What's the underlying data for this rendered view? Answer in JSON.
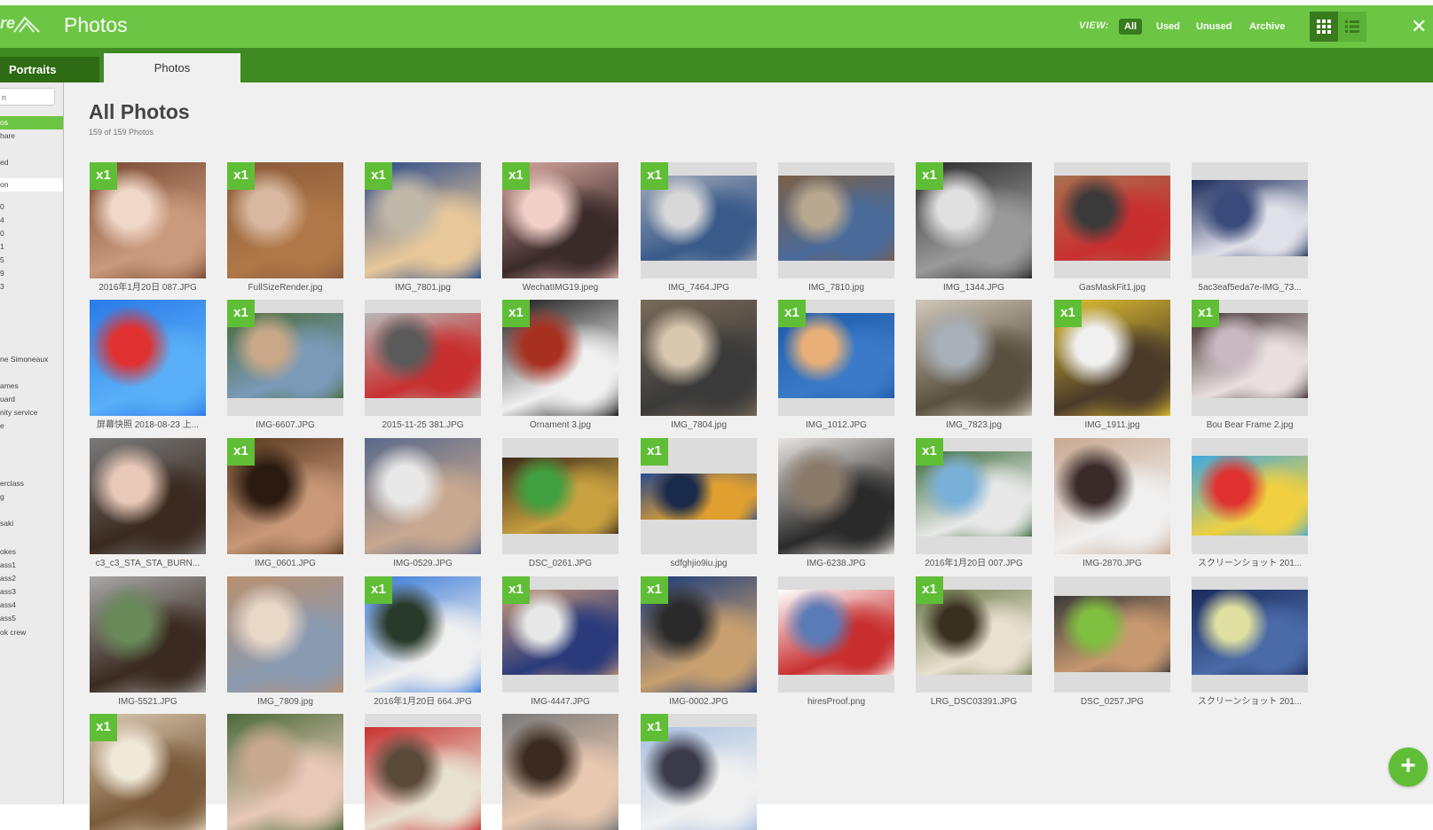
{
  "header": {
    "logo_text": "re",
    "app_title": "Photos",
    "view_label": "VIEW:",
    "view_options": [
      "All",
      "Used",
      "Unused",
      "Archive"
    ],
    "active_view": "All",
    "accent_color": "#6cc644"
  },
  "tabs": [
    {
      "label": "Portraits"
    },
    {
      "label": "Photos"
    }
  ],
  "sidebar": {
    "search_value": "n",
    "items": [
      "os",
      "hare",
      "ed",
      "on",
      "0",
      "4",
      "0",
      "1",
      "5",
      "9",
      "3",
      "",
      "ne Simoneaux",
      "ames",
      "uard",
      "nity service",
      "e",
      "erclass",
      "g",
      "saki",
      "okes",
      "ass1",
      "ass2",
      "ass3",
      "ass4",
      "ass5",
      "ok crew"
    ]
  },
  "main": {
    "heading": "All Photos",
    "count": "159 of 159 Photos",
    "badge_text": "x1",
    "photos": [
      {
        "name": "2016年1月20日 087.JPG",
        "badge": true,
        "palette": [
          "#7a4a34",
          "#c99a7c",
          "#f0d8c8"
        ]
      },
      {
        "name": "FullSizeRender.jpg",
        "badge": true,
        "palette": [
          "#8a5a3a",
          "#b07848",
          "#d8b8a0"
        ]
      },
      {
        "name": "IMG_7801.jpg",
        "badge": true,
        "palette": [
          "#2a4a8a",
          "#e8c89a",
          "#c0b8a8"
        ]
      },
      {
        "name": "WechatIMG19.jpeg",
        "badge": true,
        "palette": [
          "#d8a8a0",
          "#3a2a2a",
          "#f0d0c8"
        ]
      },
      {
        "name": "IMG_7464.JPG",
        "badge": true,
        "palette": [
          "#a0a8b8",
          "#3a5a8a",
          "#d8d8d8"
        ]
      },
      {
        "name": "IMG_7810.jpg",
        "badge": false,
        "palette": [
          "#7a6048",
          "#4a6a9a",
          "#b8a890"
        ]
      },
      {
        "name": "IMG_1344.JPG",
        "badge": true,
        "palette": [
          "#2a2a2a",
          "#9a9a9a",
          "#e0e0e0"
        ]
      },
      {
        "name": "GasMaskFit1.jpg",
        "badge": false,
        "palette": [
          "#a87050",
          "#c83030",
          "#3a3a3a"
        ]
      },
      {
        "name": "5ac3eaf5eda7e-IMG_73...",
        "badge": false,
        "palette": [
          "#1a2a5a",
          "#e0e0e8",
          "#3a4a7a"
        ]
      },
      {
        "name": "屏幕快照 2018-08-23 上...",
        "badge": false,
        "palette": [
          "#2a7ae8",
          "#5ab0f8",
          "#e03030"
        ]
      },
      {
        "name": "IMG-6607.JPG",
        "badge": true,
        "palette": [
          "#4a6a3a",
          "#7a9ab8",
          "#c8a888"
        ]
      },
      {
        "name": "2015-11-25 381.JPG",
        "badge": false,
        "palette": [
          "#b8b8b8",
          "#c83030",
          "#5a5a5a"
        ]
      },
      {
        "name": "Ornament 3.jpg",
        "badge": true,
        "palette": [
          "#1a1a1a",
          "#f0f0f0",
          "#a83020"
        ]
      },
      {
        "name": "IMG_7804.jpg",
        "badge": false,
        "palette": [
          "#7a6a58",
          "#3a3a3a",
          "#d8c8b0"
        ]
      },
      {
        "name": "IMG_1012.JPG",
        "badge": true,
        "palette": [
          "#1a5aa8",
          "#3a7ac8",
          "#e8b078"
        ]
      },
      {
        "name": "IMG_7823.jpg",
        "badge": false,
        "palette": [
          "#d0c8b8",
          "#5a5040",
          "#a8b0b8"
        ]
      },
      {
        "name": "IMG_1911.jpg",
        "badge": true,
        "palette": [
          "#e0c030",
          "#4a3a2a",
          "#f0f0f0"
        ]
      },
      {
        "name": "Bou Bear Frame 2.jpg",
        "badge": true,
        "palette": [
          "#3a2a2a",
          "#e8e0e0",
          "#c8b8c0"
        ]
      },
      {
        "name": "c3_c3_STA_STA_BURN...",
        "badge": false,
        "palette": [
          "#7a7a7a",
          "#3a2a20",
          "#e8c8b8"
        ]
      },
      {
        "name": "IMG_0601.JPG",
        "badge": true,
        "palette": [
          "#5a3a20",
          "#c89878",
          "#2a1a10"
        ]
      },
      {
        "name": "IMG-0529.JPG",
        "badge": false,
        "palette": [
          "#5a6a8a",
          "#c8a890",
          "#e8e8e8"
        ]
      },
      {
        "name": "DSC_0261.JPG",
        "badge": false,
        "palette": [
          "#3a2a1a",
          "#c8a040",
          "#40a040"
        ]
      },
      {
        "name": "sdfghjio9iu.jpg",
        "badge": true,
        "palette": [
          "#2a4a8a",
          "#e0a030",
          "#1a2a4a"
        ]
      },
      {
        "name": "IMG-6238.JPG",
        "badge": false,
        "palette": [
          "#e8e4e0",
          "#2a2a2a",
          "#8a7a6a"
        ]
      },
      {
        "name": "2016年1月20日 007.JPG",
        "badge": true,
        "palette": [
          "#3a6a3a",
          "#e8e8e8",
          "#7ab0d8"
        ]
      },
      {
        "name": "IMG-2870.JPG",
        "badge": false,
        "palette": [
          "#c8a890",
          "#f0f0f0",
          "#3a2a2a"
        ]
      },
      {
        "name": "スクリーンショット 201...",
        "badge": false,
        "palette": [
          "#40a8e0",
          "#f0d040",
          "#e03030"
        ]
      },
      {
        "name": "IMG-5521.JPG",
        "badge": false,
        "palette": [
          "#a8a8a8",
          "#3a2a20",
          "#6a8a5a"
        ]
      },
      {
        "name": "IMG_7809.jpg",
        "badge": false,
        "palette": [
          "#b89070",
          "#8a9ab0",
          "#e8d8c8"
        ]
      },
      {
        "name": "2016年1月20日 664.JPG",
        "badge": true,
        "palette": [
          "#3a7ad8",
          "#f0f0f0",
          "#2a3a2a"
        ]
      },
      {
        "name": "IMG-4447.JPG",
        "badge": true,
        "palette": [
          "#c89878",
          "#2a3a7a",
          "#e8e8e8"
        ]
      },
      {
        "name": "IMG-0002.JPG",
        "badge": true,
        "palette": [
          "#1a3a7a",
          "#c8a070",
          "#2a2a2a"
        ]
      },
      {
        "name": "hiresProof.png",
        "badge": false,
        "palette": [
          "#ffffff",
          "#c83030",
          "#5a7ab8"
        ]
      },
      {
        "name": "LRG_DSC03391.JPG",
        "badge": true,
        "palette": [
          "#6a7a4a",
          "#e8e0d0",
          "#3a3020"
        ]
      },
      {
        "name": "DSC_0257.JPG",
        "badge": false,
        "palette": [
          "#3a3a3a",
          "#c89870",
          "#80c040"
        ]
      },
      {
        "name": "スクリーンショット 201...",
        "badge": false,
        "palette": [
          "#1a2a5a",
          "#4a6aa8",
          "#e0e0a0"
        ]
      },
      {
        "name": "",
        "badge": true,
        "palette": [
          "#d8c8b0",
          "#7a5a3a",
          "#f0e8d8"
        ]
      },
      {
        "name": "",
        "badge": false,
        "palette": [
          "#4a6a3a",
          "#e8c8b8",
          "#c8a890"
        ]
      },
      {
        "name": "",
        "badge": false,
        "palette": [
          "#c83030",
          "#e8e0d0",
          "#5a4a3a"
        ]
      },
      {
        "name": "",
        "badge": false,
        "palette": [
          "#7a7a7a",
          "#e8c8b0",
          "#3a2a20"
        ]
      },
      {
        "name": "",
        "badge": true,
        "palette": [
          "#a8c0e0",
          "#f0f0f0",
          "#3a3a4a"
        ]
      }
    ]
  },
  "fab": {
    "label": "+"
  }
}
